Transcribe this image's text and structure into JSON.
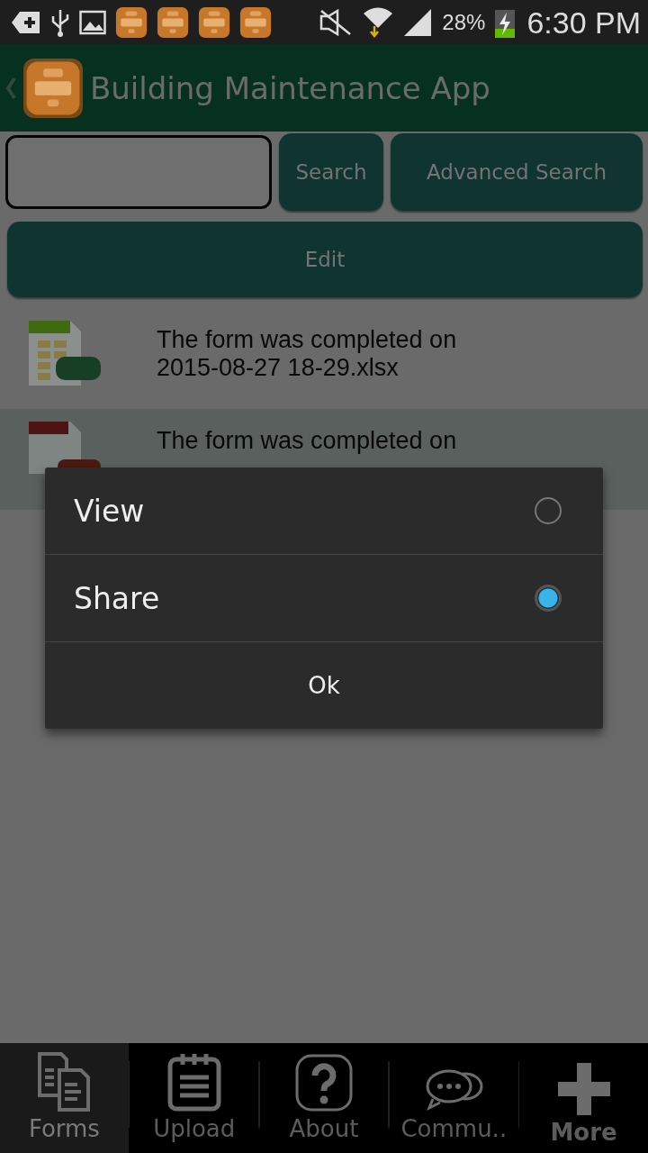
{
  "status_bar": {
    "battery": "28%",
    "time": "6:30 PM"
  },
  "header": {
    "title": "Building Maintenance App"
  },
  "search": {
    "button": "Search",
    "advanced_button": "Advanced Search"
  },
  "edit_button": "Edit",
  "files": [
    {
      "kind": "xls",
      "title": "The form was completed on",
      "name": "2015-08-27 18-29.xlsx",
      "selected": false
    },
    {
      "kind": "pdf",
      "title": "The form was completed on",
      "selected": true
    }
  ],
  "dialog": {
    "options": [
      {
        "label": "View",
        "selected": false
      },
      {
        "label": "Share",
        "selected": true
      }
    ],
    "button": "Ok"
  },
  "tabs": [
    {
      "kind": "forms",
      "label": "Forms",
      "selected": true
    },
    {
      "kind": "upload",
      "label": "Upload",
      "selected": false
    },
    {
      "kind": "about",
      "label": "About",
      "selected": false
    },
    {
      "kind": "chat",
      "label": "Commu..",
      "selected": false
    },
    {
      "kind": "more",
      "label": "More",
      "selected": false
    }
  ]
}
